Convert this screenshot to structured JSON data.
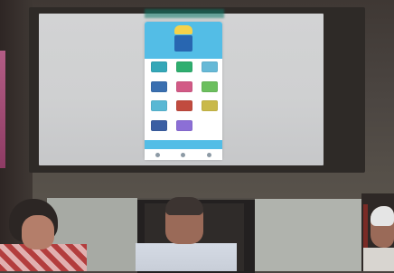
{
  "scene": {
    "phone_app": {
      "header_title": "",
      "tiles": [
        {
          "label": "",
          "icon": "tile-teal-icon",
          "color": "#34a7b8"
        },
        {
          "label": "",
          "icon": "tile-green-icon",
          "color": "#2fae6f"
        },
        {
          "label": "",
          "icon": "tile-aqua-icon",
          "color": "#66b9d7"
        },
        {
          "label": "",
          "icon": "tile-blue-icon",
          "color": "#3a6fb0"
        },
        {
          "label": "",
          "icon": "tile-pink-icon",
          "color": "#d25a86"
        },
        {
          "label": "",
          "icon": "tile-lime-icon",
          "color": "#6cbf5e"
        },
        {
          "label": "",
          "icon": "tile-cyan-icon",
          "color": "#59b8d4"
        },
        {
          "label": "",
          "icon": "tile-red-icon",
          "color": "#c14b3f"
        },
        {
          "label": "",
          "icon": "tile-yellow-icon",
          "color": "#c9b94a"
        },
        {
          "label": "",
          "icon": "tile-navy-icon",
          "color": "#3b5fa3"
        },
        {
          "label": "",
          "icon": "tile-violet-icon",
          "color": "#8c6fd6"
        },
        {
          "label": "",
          "icon": "tile-empty-icon",
          "color": "#ffffff"
        }
      ]
    },
    "colors": {
      "wall": "#4b4541",
      "screen": "#cfd0d1",
      "phone_header": "#53bde6",
      "door": "#232020"
    }
  }
}
